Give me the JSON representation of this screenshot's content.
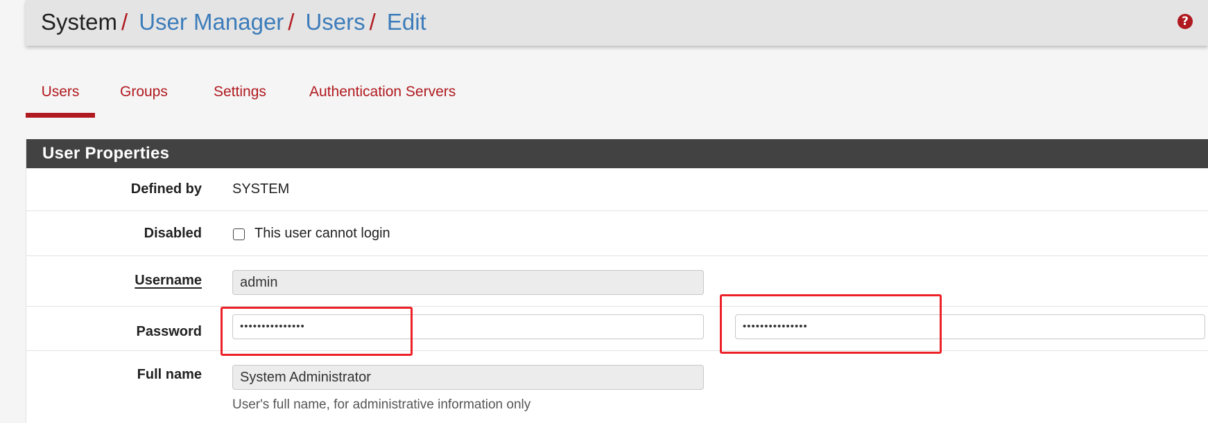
{
  "breadcrumb": {
    "root": "System",
    "items": [
      "User Manager",
      "Users",
      "Edit"
    ],
    "separator": "/"
  },
  "help_icon": {
    "glyph": "?",
    "name": "help-icon"
  },
  "tabs": [
    {
      "label": "Users",
      "active": true
    },
    {
      "label": "Groups",
      "active": false
    },
    {
      "label": "Settings",
      "active": false
    },
    {
      "label": "Authentication Servers",
      "active": false
    }
  ],
  "panel": {
    "title": "User Properties",
    "defined_by": {
      "label": "Defined by",
      "value": "SYSTEM"
    },
    "disabled": {
      "label": "Disabled",
      "checkbox_label": "This user cannot login",
      "checked": false
    },
    "username": {
      "label": "Username",
      "value": "admin"
    },
    "password": {
      "label": "Password",
      "value": "•••••••••••••••",
      "confirm_value": "•••••••••••••••"
    },
    "full_name": {
      "label": "Full name",
      "value": "System Administrator",
      "help": "User's full name, for administrative information only"
    }
  },
  "colors": {
    "accent": "#b0191f",
    "link": "#3c7cba",
    "panel_header": "#424242",
    "highlight": "#ec2127"
  }
}
